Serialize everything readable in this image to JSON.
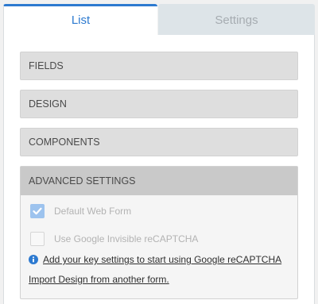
{
  "tabs": {
    "list_label": "List",
    "settings_label": "Settings"
  },
  "sections": {
    "fields": "FIELDS",
    "design": "DESIGN",
    "components": "COMPONENTS",
    "advanced": "ADVANCED SETTINGS"
  },
  "advanced": {
    "default_web_form": {
      "label": "Default Web Form",
      "checked": true
    },
    "recaptcha": {
      "label": "Use Google Invisible reCAPTCHA",
      "checked": false
    },
    "key_settings_link": "Add your key settings to start using Google reCAPTCHA",
    "import_design_link": "Import Design from another form."
  },
  "colors": {
    "accent": "#2d7ad0",
    "info_icon": "#2d7ad0",
    "checkbox_checked": "#9dc3ee"
  },
  "icons": {
    "checked": "check-icon",
    "info": "info-icon"
  }
}
